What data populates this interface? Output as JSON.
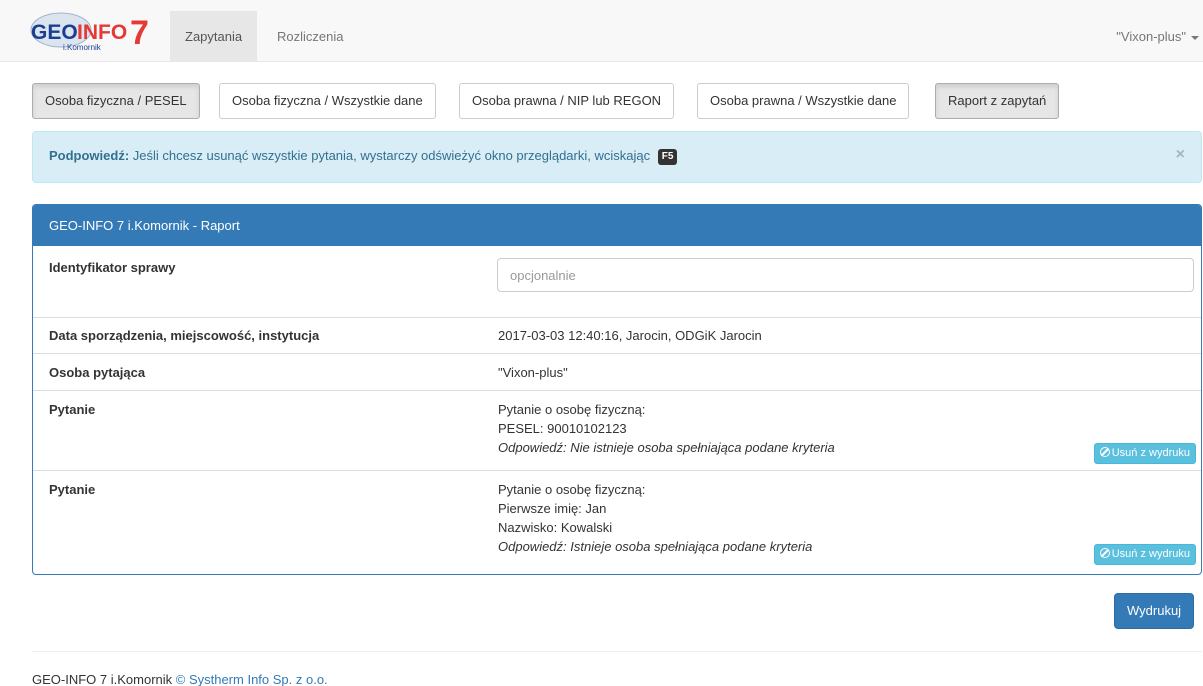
{
  "navbar": {
    "logo_text_main": "GEOINFO",
    "logo_text_num": "7",
    "logo_sub": "i.Komornik",
    "tabs": [
      {
        "label": "Zapytania"
      },
      {
        "label": "Rozliczenia"
      }
    ],
    "user": "\"Vixon-plus\""
  },
  "buttons": [
    {
      "label": "Osoba fizyczna / PESEL"
    },
    {
      "label": "Osoba fizyczna / Wszystkie dane"
    },
    {
      "label": "Osoba prawna / NIP lub REGON"
    },
    {
      "label": "Osoba prawna / Wszystkie dane"
    },
    {
      "label": "Raport z zapytań"
    }
  ],
  "alert": {
    "strong": "Podpowiedź:",
    "text": " Jeśli chcesz usunąć wszystkie pytania, wystarczy odświeżyć okno przeglądarki, wciskając",
    "key": "F5",
    "close": "×"
  },
  "panel": {
    "title": "GEO-INFO 7 i.Komornik - Raport",
    "case_id_label": "Identyfikator sprawy",
    "case_id_placeholder": "opcjonalnie",
    "date_label": "Data sporządzenia, miejscowość, instytucja",
    "date_value": "2017-03-03 12:40:16, Jarocin, ODGiK Jarocin",
    "person_label": "Osoba pytająca",
    "person_value": "\"Vixon-plus\"",
    "questions": [
      {
        "label": "Pytanie",
        "line1": "Pytanie o osobę fizyczną:",
        "line2": "PESEL: 90010102123",
        "line3": "",
        "answer_label": "Odpowiedź:",
        "answer": " Nie istnieje osoba spełniająca podane kryteria",
        "remove": "Usuń z wydruku"
      },
      {
        "label": "Pytanie",
        "line1": "Pytanie o osobę fizyczną:",
        "line2": "Pierwsze imię: Jan",
        "line3": "Nazwisko: Kowalski",
        "answer_label": "Odpowiedź:",
        "answer": " Istnieje osoba spełniająca podane kryteria",
        "remove": "Usuń z wydruku"
      }
    ]
  },
  "print_label": "Wydrukuj",
  "footer": {
    "text": "GEO-INFO 7 i.Komornik ",
    "link": "© Systherm Info Sp. z o.o."
  },
  "colors": {
    "primary": "#337ab7",
    "info_bg": "#d9edf7",
    "info_text": "#31708f",
    "remove_btn": "#5bc0de",
    "logo_red": "#e53935",
    "logo_blue": "#1a3f8f"
  }
}
